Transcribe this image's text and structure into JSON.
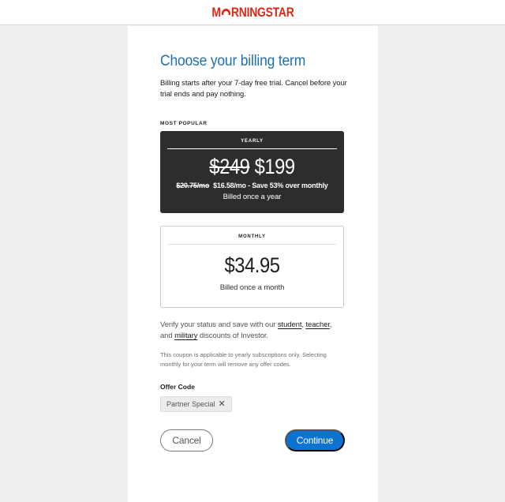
{
  "header": {
    "logo_text_before": "M",
    "logo_text_after": "RNINGSTAR",
    "brand_color": "#e12617"
  },
  "billing": {
    "title": "Choose your billing term",
    "subtitle": "Billing starts after your 7-day free trial. Cancel before your trial ends and pay nothing.",
    "popular_label": "MOST POPULAR",
    "yearly": {
      "label": "YEARLY",
      "old_price": "$249",
      "price": "$199",
      "old_monthly": "$20.75/mo",
      "monthly_savings": "$16.58/mo - Save 53% over monthly",
      "billed": "Billed once a year"
    },
    "monthly": {
      "label": "MONTHLY",
      "price": "$34.95",
      "billed": "Billed once a month"
    },
    "verify": {
      "prefix": "Verify your status and save with our ",
      "student": "student",
      "comma": ", ",
      "teacher": "teacher",
      "and": ", and ",
      "military": "military",
      "suffix": " discounts of Investor."
    },
    "coupon_note": "This coupon is applicable to yearly subscriptions only. Selecting monthly for your term will remove any offer codes.",
    "offer_label": "Offer Code",
    "offer_code": "Partner Special",
    "remove_icon": "close-icon",
    "cancel_label": "Cancel",
    "continue_label": "Continue",
    "accent_color": "#0c73d3",
    "title_color": "#1f6fad"
  }
}
